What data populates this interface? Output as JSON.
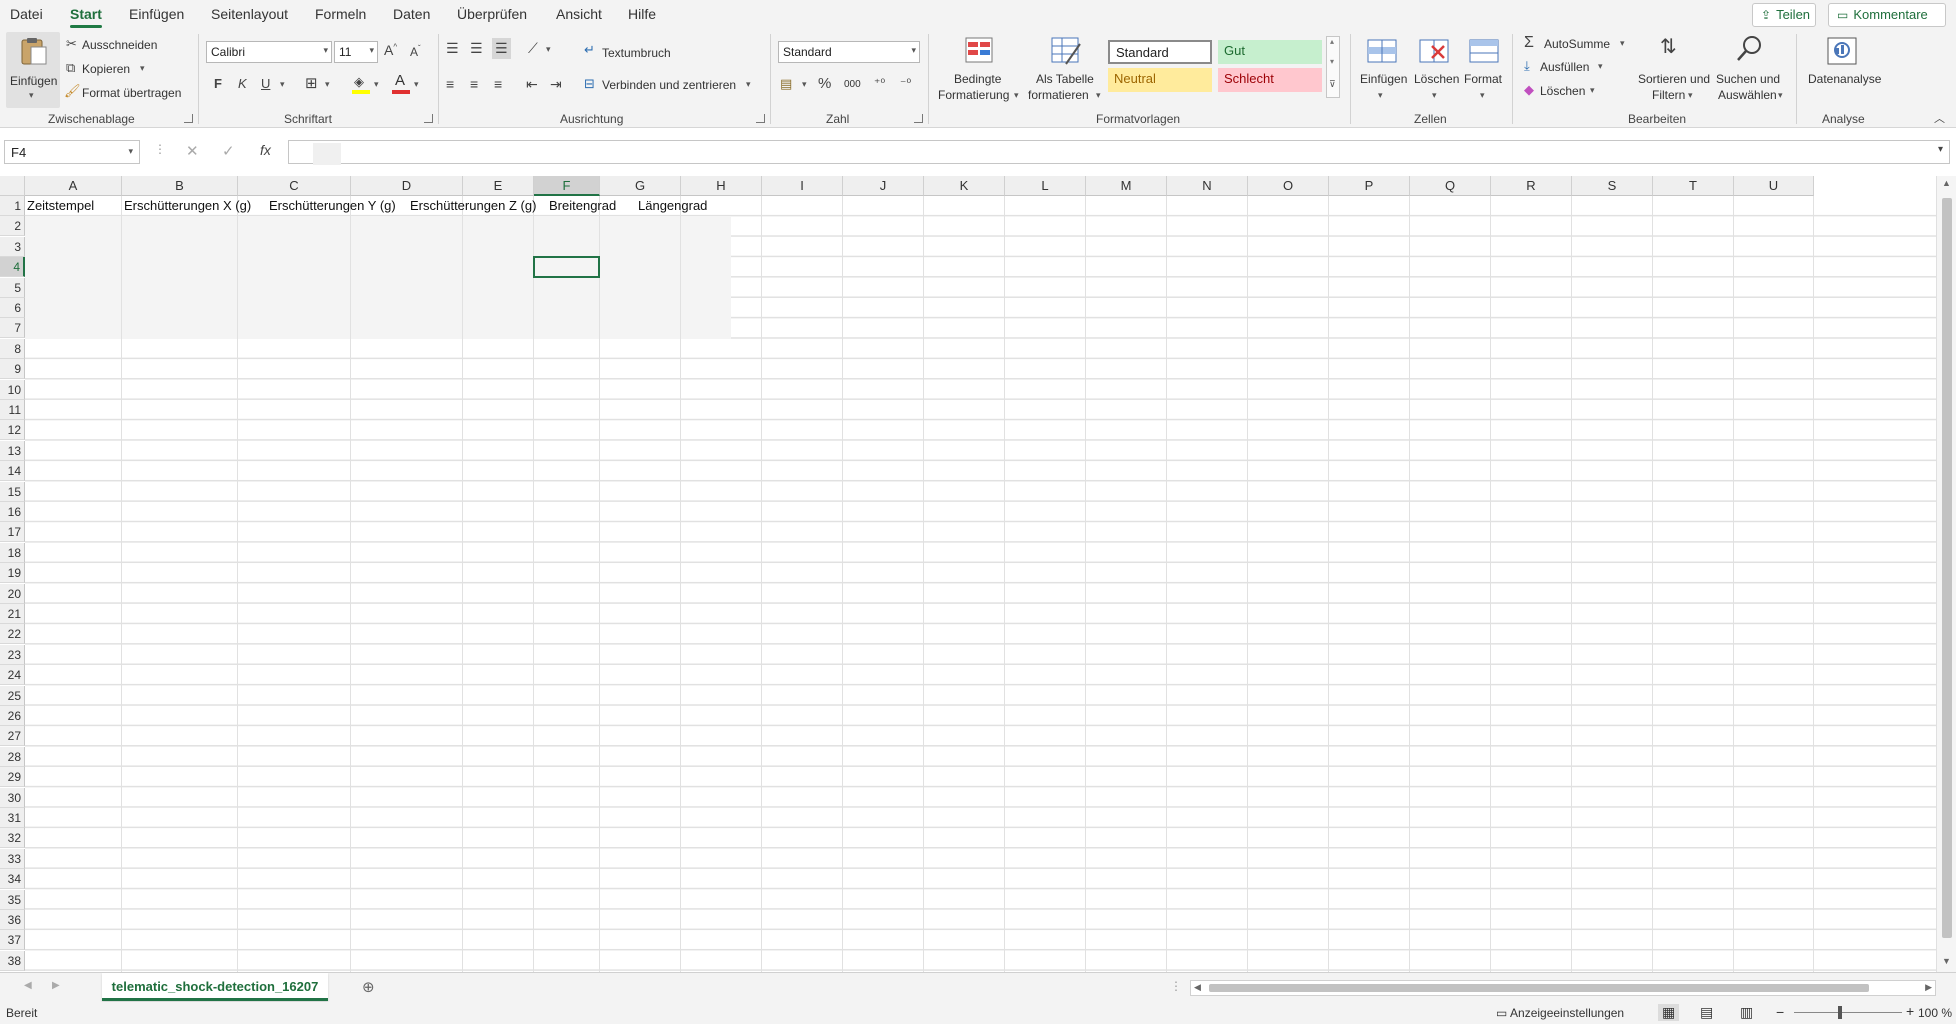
{
  "menu": {
    "tabs": [
      "Datei",
      "Start",
      "Einfügen",
      "Seitenlayout",
      "Formeln",
      "Daten",
      "Überprüfen",
      "Ansicht",
      "Hilfe"
    ],
    "share_label": "Teilen",
    "comments_label": "Kommentare"
  },
  "ribbon": {
    "clipboard": {
      "paste": "Einfügen",
      "cut": "Ausschneiden",
      "copy": "Kopieren",
      "format_painter": "Format übertragen",
      "group": "Zwischenablage"
    },
    "font": {
      "name": "Calibri",
      "size": "11",
      "bold": "F",
      "italic": "K",
      "underline": "U",
      "group": "Schriftart"
    },
    "alignment": {
      "wrap": "Textumbruch",
      "merge": "Verbinden und zentrieren",
      "group": "Ausrichtung"
    },
    "number": {
      "format": "Standard",
      "percent": "%",
      "thousands": "000",
      "group": "Zahl"
    },
    "styles": {
      "conditional": [
        "Bedingte",
        "Formatierung"
      ],
      "as_table": [
        "Als Tabelle",
        "formatieren"
      ],
      "standard": "Standard",
      "good": "Gut",
      "neutral": "Neutral",
      "bad": "Schlecht",
      "group": "Formatvorlagen"
    },
    "cells": {
      "insert": "Einfügen",
      "delete": "Löschen",
      "format": "Format",
      "group": "Zellen"
    },
    "editing": {
      "autosum": "AutoSumme",
      "fill": "Ausfüllen",
      "clear": "Löschen",
      "sort": [
        "Sortieren und",
        "Filtern"
      ],
      "find": [
        "Suchen und",
        "Auswählen"
      ],
      "group": "Bearbeiten"
    },
    "analysis": {
      "data_analysis": "Datenanalyse",
      "group": "Analyse"
    }
  },
  "formula_bar": {
    "name_box": "F4",
    "content": ""
  },
  "grid": {
    "columns": [
      "A",
      "B",
      "C",
      "D",
      "E",
      "F",
      "G",
      "H",
      "I",
      "J",
      "K",
      "L",
      "M",
      "N",
      "O",
      "P",
      "Q",
      "R",
      "S",
      "T",
      "U"
    ],
    "selected_column": "F",
    "selected_row": 4,
    "header_row": [
      "Zeitstempel",
      "Erschütterungen X (g)",
      "Erschütterungen Y (g)",
      "Erschütterungen Z (g)",
      "Breitengrad",
      "Längengrad"
    ],
    "row_numbers": [
      "1",
      "2",
      "3",
      "4",
      "5",
      "6",
      "7",
      "8",
      "9",
      "10",
      "11",
      "12",
      "13",
      "14",
      "15",
      "16",
      "17",
      "18",
      "19",
      "20",
      "21",
      "22",
      "23",
      "24",
      "25",
      "26",
      "27",
      "28",
      "29",
      "30",
      "31",
      "32",
      "33",
      "34",
      "35",
      "36",
      "37",
      "38"
    ]
  },
  "sheet_tabs": {
    "active": "telematic_shock-detection_16207"
  },
  "status": {
    "ready": "Bereit",
    "display_settings": "Anzeigeeinstellungen",
    "zoom": "100 %"
  },
  "colors": {
    "accent": "#217346",
    "good_bg": "#c6efce",
    "neutral_bg": "#ffeb9c",
    "bad_bg": "#ffc7ce"
  }
}
